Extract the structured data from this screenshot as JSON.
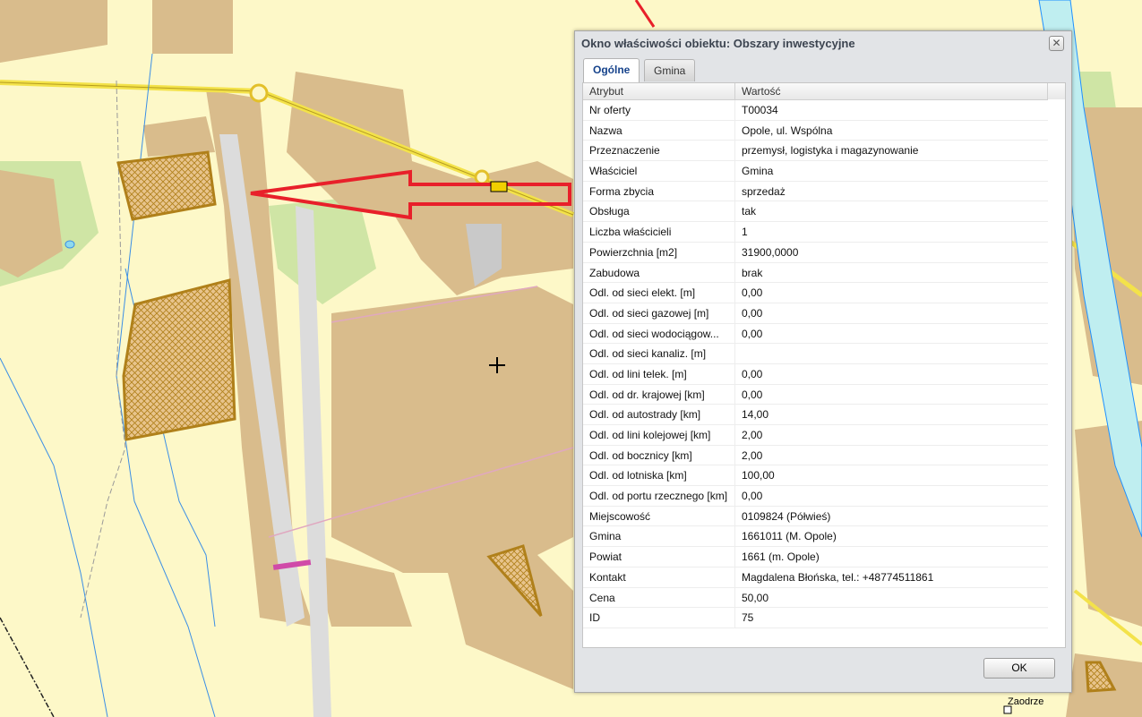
{
  "dialog": {
    "title": "Okno właściwości obiektu: Obszary inwestycyjne",
    "tabs": [
      "Ogólne",
      "Gmina"
    ],
    "columns": [
      "Atrybut",
      "Wartość"
    ],
    "rows": [
      {
        "attr": "Nr oferty",
        "value": "T00034"
      },
      {
        "attr": "Nazwa",
        "value": "Opole, ul. Wspólna"
      },
      {
        "attr": "Przeznaczenie",
        "value": "przemysł, logistyka i magazynowanie"
      },
      {
        "attr": "Właściciel",
        "value": "Gmina"
      },
      {
        "attr": "Forma zbycia",
        "value": "sprzedaż"
      },
      {
        "attr": "Obsługa",
        "value": "tak"
      },
      {
        "attr": "Liczba właścicieli",
        "value": "1"
      },
      {
        "attr": "Powierzchnia [m2]",
        "value": "31900,0000"
      },
      {
        "attr": "Zabudowa",
        "value": "brak"
      },
      {
        "attr": "Odl. od sieci elekt. [m]",
        "value": "0,00"
      },
      {
        "attr": "Odl. od sieci gazowej [m]",
        "value": "0,00"
      },
      {
        "attr": "Odl. od sieci wodociągow...",
        "value": "0,00"
      },
      {
        "attr": "Odl. od sieci kanaliz. [m]",
        "value": ""
      },
      {
        "attr": "Odl. od lini telek. [m]",
        "value": "0,00"
      },
      {
        "attr": "Odl. od dr. krajowej [km]",
        "value": "0,00"
      },
      {
        "attr": "Odl. od autostrady [km]",
        "value": "14,00"
      },
      {
        "attr": "Odl. od lini kolejowej [km]",
        "value": "2,00"
      },
      {
        "attr": "Odl. od bocznicy [km]",
        "value": "2,00"
      },
      {
        "attr": "Odl. od lotniska [km]",
        "value": "100,00"
      },
      {
        "attr": "Odl. od portu rzecznego [km]",
        "value": "0,00"
      },
      {
        "attr": "Miejscowość",
        "value": "0109824 (Półwieś)"
      },
      {
        "attr": "Gmina",
        "value": "1661011 (M. Opole)"
      },
      {
        "attr": "Powiat",
        "value": "1661 (m. Opole)"
      },
      {
        "attr": "Kontakt",
        "value": "Magdalena Błońska, tel.: +48774511861"
      },
      {
        "attr": "Cena",
        "value": "50,00"
      },
      {
        "attr": "ID",
        "value": "75"
      }
    ],
    "ok_label": "OK",
    "close_glyph": "✕"
  },
  "map": {
    "place_label": "Zaodrze",
    "colors": {
      "background": "#fdf8c8",
      "built_area": "#d9bc8c",
      "forest": "#cfe5a5",
      "investment_area_outline": "#b0801a",
      "water": "#1e90ff",
      "arrow": "#e8202a",
      "road": "#f3e24a"
    }
  }
}
